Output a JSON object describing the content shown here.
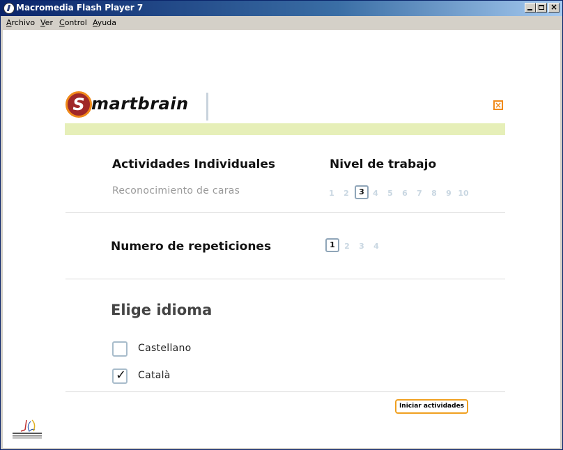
{
  "window": {
    "title": "Macromedia Flash Player 7"
  },
  "menu": [
    "Archivo",
    "Ver",
    "Control",
    "Ayuda"
  ],
  "logo": {
    "first_letter": "S",
    "rest": "martbrain"
  },
  "activities": {
    "heading": "Actividades Individuales",
    "activity_name": "Reconocimiento de caras"
  },
  "level": {
    "heading": "Nivel de trabajo",
    "options": [
      "1",
      "2",
      "3",
      "4",
      "5",
      "6",
      "7",
      "8",
      "9",
      "10"
    ],
    "selected": "3"
  },
  "repetitions": {
    "heading": "Numero de repeticiones",
    "options": [
      "1",
      "2",
      "3",
      "4"
    ],
    "selected": "1"
  },
  "language": {
    "heading": "Elige idioma",
    "options": [
      {
        "label": "Castellano",
        "checked": false
      },
      {
        "label": "Català",
        "checked": true
      }
    ]
  },
  "start_button": "Iniciar actividades",
  "colors": {
    "accent": "#f08a1a",
    "brand": "#a02828",
    "band": "#e6efb8"
  }
}
